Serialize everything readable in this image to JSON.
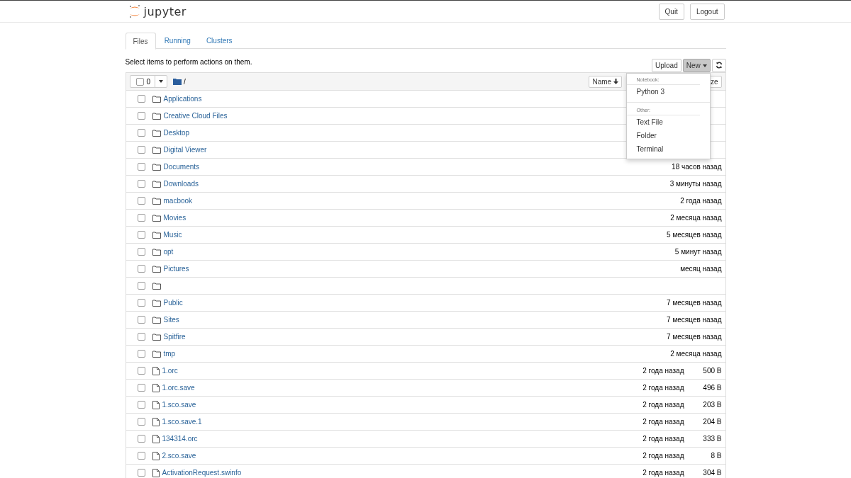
{
  "header": {
    "logo_text": "jupyter",
    "buttons": [
      "Quit",
      "Logout"
    ]
  },
  "tabs": [
    {
      "label": "Files",
      "selected": true
    },
    {
      "label": "Running",
      "selected": false
    },
    {
      "label": "Clusters",
      "selected": false
    }
  ],
  "toolbar": {
    "hint": "Select items to perform actions on them.",
    "upload": "Upload",
    "new": {
      "label": "New",
      "expanded": true
    }
  },
  "list_header": {
    "all_checked": false,
    "selected_count": "0",
    "path": "/",
    "sort_button": "Name",
    "column_3": "ze"
  },
  "new_menu": [
    {
      "heading": "Notebook:",
      "items": [
        "Python 3"
      ]
    },
    {
      "heading": "Other:",
      "items": [
        "Text File",
        "Folder",
        "Terminal"
      ]
    }
  ],
  "rows": [
    {
      "kind": "folder",
      "name": "Applications",
      "checked": false
    },
    {
      "kind": "folder",
      "name": "Creative Cloud Files",
      "checked": false
    },
    {
      "kind": "folder",
      "name": "Desktop",
      "checked": false
    },
    {
      "kind": "folder",
      "name": "Digital Viewer",
      "checked": false
    },
    {
      "kind": "folder",
      "name": "Documents",
      "modified": "18 часов назад",
      "checked": false
    },
    {
      "kind": "folder",
      "name": "Downloads",
      "modified": "3 минуты назад",
      "checked": false
    },
    {
      "kind": "folder",
      "name": "macbook",
      "modified": "2 года назад",
      "checked": false
    },
    {
      "kind": "folder",
      "name": "Movies",
      "modified": "2 месяца назад",
      "checked": false
    },
    {
      "kind": "folder",
      "name": "Music",
      "modified": "5 месяцев назад",
      "checked": false
    },
    {
      "kind": "folder",
      "name": "opt",
      "modified": "5 минут назад",
      "checked": false
    },
    {
      "kind": "folder",
      "name": "Pictures",
      "modified": "месяц назад",
      "checked": false
    },
    {
      "kind": "folder",
      "checked": false
    },
    {
      "kind": "folder",
      "name": "Public",
      "modified": "7 месяцев назад",
      "checked": false
    },
    {
      "kind": "folder",
      "name": "Sites",
      "modified": "7 месяцев назад",
      "checked": false
    },
    {
      "kind": "folder",
      "name": "Spitfire",
      "modified": "7 месяцев назад",
      "checked": false
    },
    {
      "kind": "folder",
      "name": "tmp",
      "modified": "2 месяца назад",
      "checked": false
    },
    {
      "kind": "file",
      "name": "1.orc",
      "modified": "2 года назад",
      "size": "500 B",
      "checked": false
    },
    {
      "kind": "file",
      "name": "1.orc.save",
      "modified": "2 года назад",
      "size": "496 B",
      "checked": false
    },
    {
      "kind": "file",
      "name": "1.sco.save",
      "modified": "2 года назад",
      "size": "203 B",
      "checked": false
    },
    {
      "kind": "file",
      "name": "1.sco.save.1",
      "modified": "2 года назад",
      "size": "204 B",
      "checked": false
    },
    {
      "kind": "file",
      "name": "134314.orc",
      "modified": "2 года назад",
      "size": "333 B",
      "checked": false
    },
    {
      "kind": "file",
      "name": "2.sco.save",
      "modified": "2 года назад",
      "size": "8 B",
      "checked": false
    },
    {
      "kind": "file",
      "name": "ActivationRequest.swinfo",
      "modified": "2 года назад",
      "size": "304 B",
      "checked": false
    }
  ]
}
